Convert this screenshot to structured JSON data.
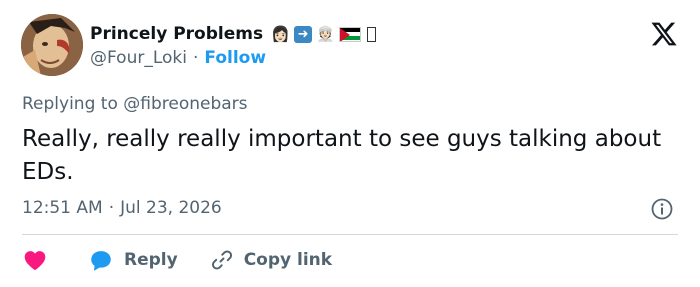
{
  "author": {
    "display_name": "Princely Problems",
    "handle": "@Four_Loki",
    "separator": "·",
    "follow_label": "Follow",
    "name_emojis": [
      "👩🏻",
      "➡️",
      "👳🏻",
      "flag-palestine",
      "□"
    ]
  },
  "reply_context": {
    "prefix": "Replying to",
    "mention": "@fibreonebars"
  },
  "tweet": {
    "text": "Really, really really important to see guys talking about EDs.",
    "time": "12:51 AM",
    "separator": "·",
    "date": "Jul 23, 2026"
  },
  "actions": {
    "like_icon": "heart-icon",
    "reply_label": "Reply",
    "copy_link_label": "Copy link"
  },
  "colors": {
    "accent": "#1d9bf0",
    "like": "#f91880",
    "text_primary": "#0f1419",
    "text_secondary": "#536471",
    "divider": "#cfd9de"
  }
}
